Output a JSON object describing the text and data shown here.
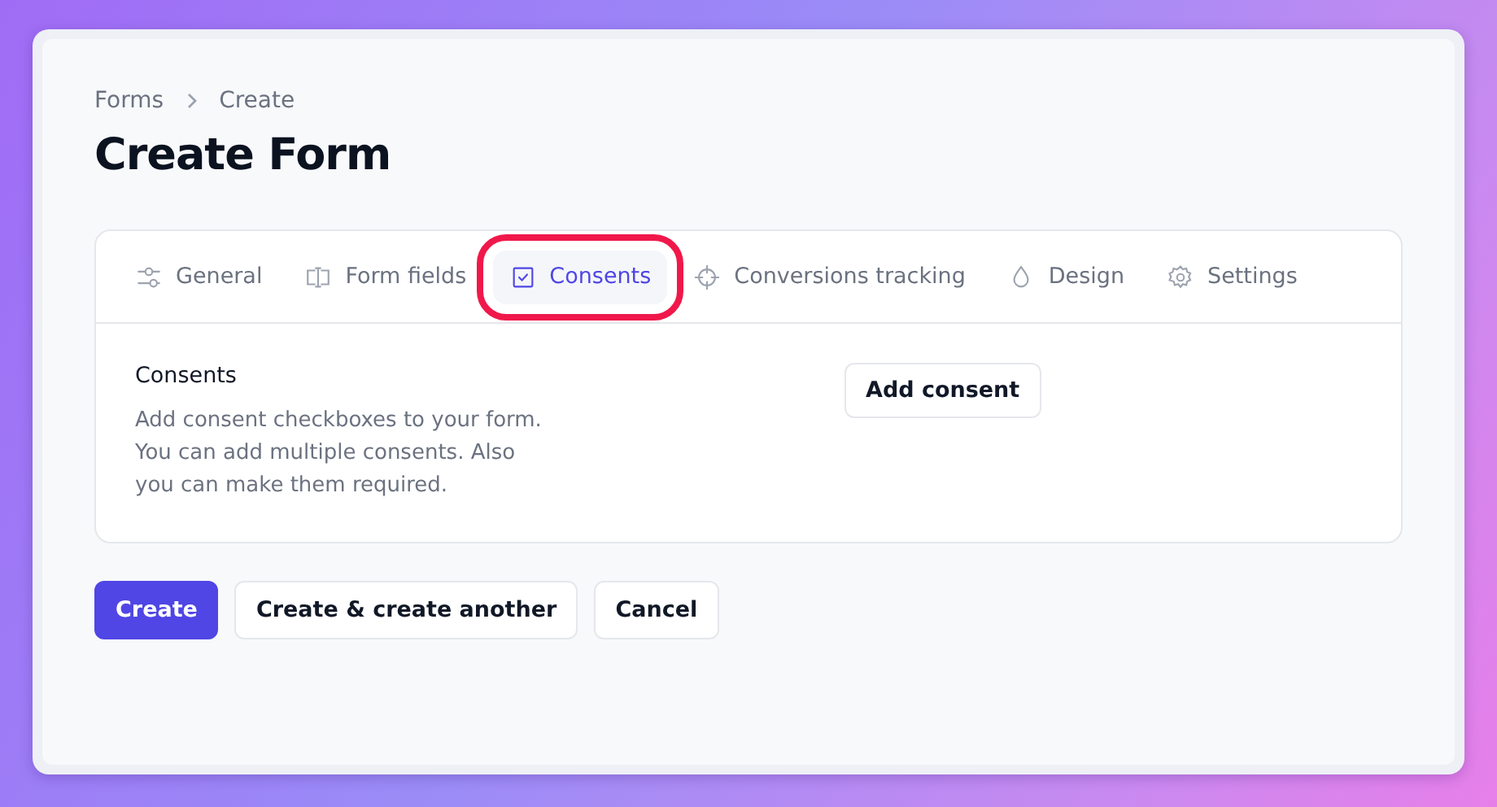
{
  "breadcrumbs": [
    "Forms",
    "Create"
  ],
  "title": "Create Form",
  "tabs": [
    {
      "label": "General",
      "selected": false,
      "highlighted": false
    },
    {
      "label": "Form fields",
      "selected": false,
      "highlighted": false
    },
    {
      "label": "Consents",
      "selected": true,
      "highlighted": true
    },
    {
      "label": "Conversions tracking",
      "selected": false,
      "highlighted": false
    },
    {
      "label": "Design",
      "selected": false,
      "highlighted": false
    },
    {
      "label": "Settings",
      "selected": false,
      "highlighted": false
    }
  ],
  "section": {
    "heading": "Consents",
    "description": "Add consent checkboxes to your form. You can add multiple consents. Also you can make them required.",
    "button": "Add consent"
  },
  "actions": [
    {
      "label": "Create",
      "kind": "primary"
    },
    {
      "label": "Create & create another",
      "kind": "secondary"
    },
    {
      "label": "Cancel",
      "kind": "secondary"
    }
  ]
}
